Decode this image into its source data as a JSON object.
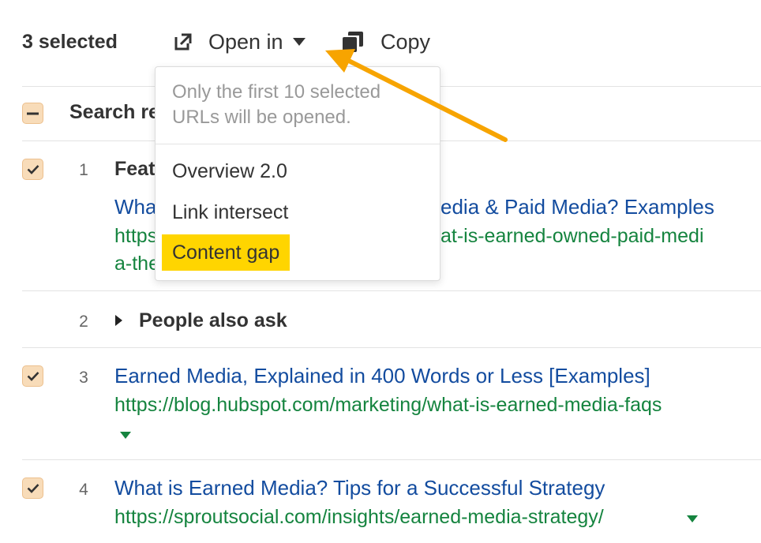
{
  "toolbar": {
    "selected_label": "3 selected",
    "open_in_label": "Open in",
    "copy_label": "Copy"
  },
  "table_header": {
    "column_label": "Search re"
  },
  "rows": [
    {
      "number": "1",
      "title_prefix": "Feat",
      "link_title_left": "What",
      "link_title_right": "edia & Paid Media? Examples",
      "url_left_1": "https:",
      "url_right_1": "at-is-earned-owned-paid-medi",
      "url_left_2": "a-the",
      "checked": true
    },
    {
      "number": "2",
      "label": "People also ask"
    },
    {
      "number": "3",
      "link_title": "Earned Media, Explained in 400 Words or Less [Examples]",
      "url": "https://blog.hubspot.com/marketing/what-is-earned-media-faqs",
      "checked": true
    },
    {
      "number": "4",
      "link_title": "What is Earned Media? Tips for a Successful Strategy",
      "url": "https://sproutsocial.com/insights/earned-media-strategy/",
      "checked": true
    }
  ],
  "dropdown": {
    "note": "Only the first 10 selected URLs will be opened.",
    "items": [
      {
        "label": "Overview 2.0"
      },
      {
        "label": "Link intersect"
      },
      {
        "label": "Content gap",
        "highlighted": true
      }
    ]
  },
  "colors": {
    "link": "#134c9f",
    "url": "#15843f",
    "checkbox_bg": "#f8dcb9",
    "highlight": "#ffd500",
    "annotation_arrow": "#f7a400"
  },
  "icons": {
    "open_in": "external-link-icon",
    "copy": "copy-icon",
    "dropdown": "caret-down-icon",
    "checkbox": "checkmark-icon",
    "indeterminate": "minus-icon",
    "expand": "triangle-right-icon"
  }
}
